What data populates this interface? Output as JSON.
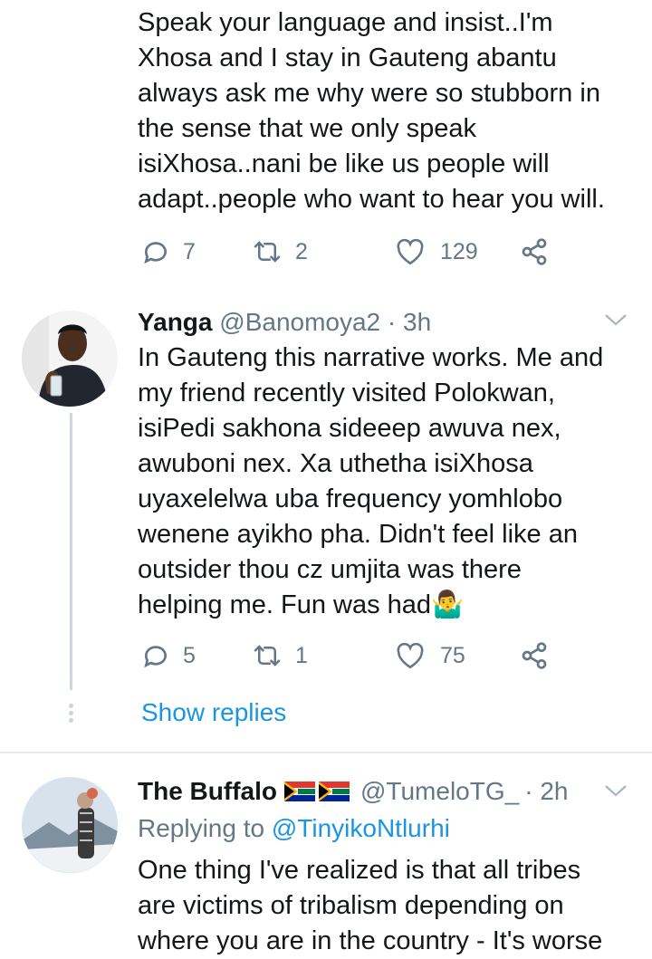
{
  "tweet1": {
    "text": "Speak your language and insist..I'm\nXhosa and I stay in Gauteng abantu\nalways ask me why were so stubborn in\nthe sense that we only speak\nisiXhosa..nani be like us people will\nadapt..people who want to hear you will.",
    "replies": "7",
    "retweets": "2",
    "likes": "129"
  },
  "tweet2": {
    "name": "Yanga",
    "handle": "@Banomoya2",
    "time": "· 3h",
    "text": "In Gauteng this narrative works. Me and\nmy friend recently visited Polokwan,\nisiPedi sakhona sideeep awuva nex,\nawuboni nex. Xa uthetha isiXhosa\nuyaxelelwa uba frequency yomhlobo\nwenene ayikho pha. Didn't feel like an\noutsider thou cz umjita was there\nhelping me. Fun was had",
    "emoji": "🤷‍♂️",
    "replies": "5",
    "retweets": "1",
    "likes": "75"
  },
  "show_replies": "Show replies",
  "tweet3": {
    "name": "The Buffalo",
    "handle": "@TumeloTG_",
    "time": "· 2h",
    "replying_prefix": "Replying to ",
    "replying_to": "@TinyikoNtlurhi",
    "text": "One thing I've realized is that all tribes\nare victims of tribalism depending on\nwhere you are in the country - It's worse"
  },
  "icons": {
    "reply": "reply-icon",
    "retweet": "retweet-icon",
    "like": "heart-icon",
    "share": "share-icon",
    "more": "chevron-down-icon",
    "flag": "south-africa-flag-icon"
  },
  "colors": {
    "text": "#14171a",
    "secondary": "#657786",
    "link": "#1b95e0",
    "thread": "#ccd6dd"
  }
}
